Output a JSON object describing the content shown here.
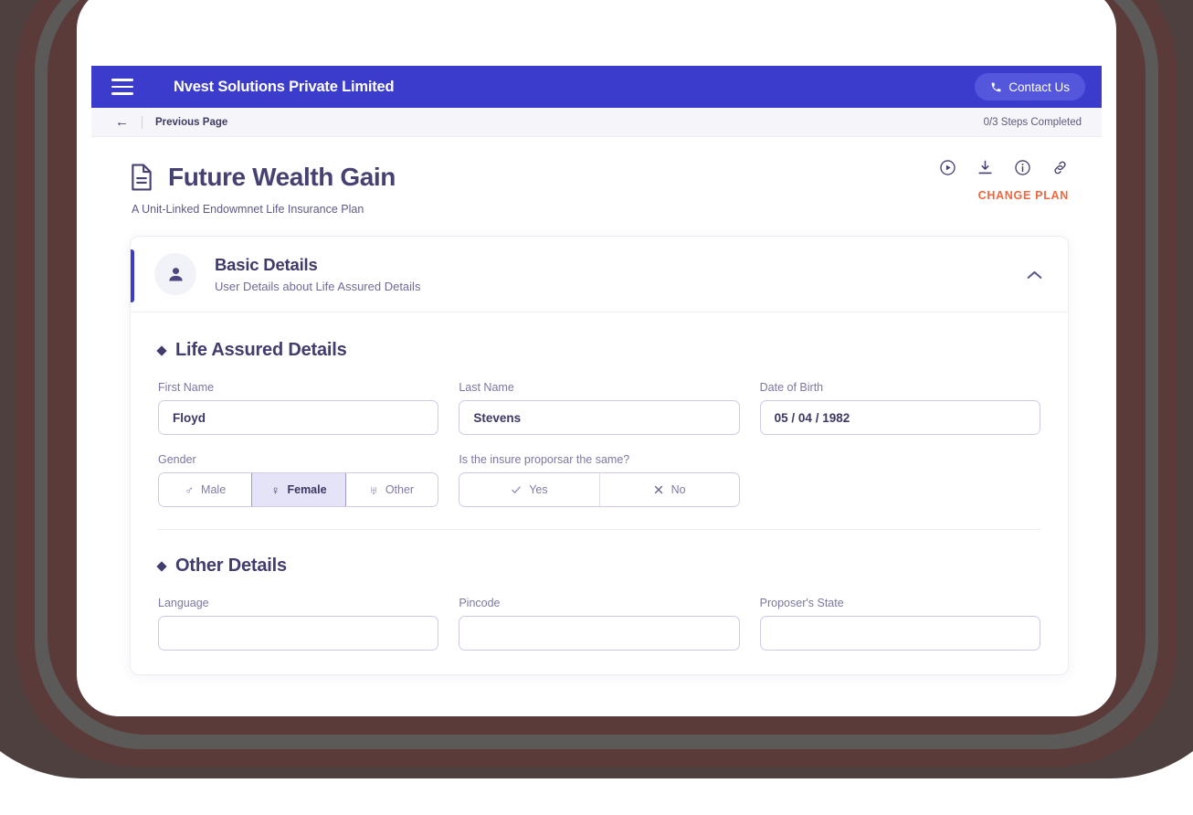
{
  "appbar": {
    "menu_icon": "hamburger-menu-icon",
    "brand": "Nvest Solutions Private Limited",
    "contact_label": "Contact Us",
    "contact_icon": "phone-icon",
    "bg_color": "#3b3ccc",
    "contact_bg_color": "#5457db"
  },
  "subbar": {
    "back_icon": "arrow-left-icon",
    "previous_page": "Previous Page",
    "steps": "0/3 Steps Completed"
  },
  "plan": {
    "doc_icon": "document-icon",
    "title": "Future Wealth Gain",
    "subtitle": "A Unit-Linked Endowmnet Life Insurance Plan",
    "change_plan": "CHANGE PLAN",
    "change_plan_color": "#f4663f",
    "actions": [
      {
        "name": "play-circle-icon"
      },
      {
        "name": "download-icon"
      },
      {
        "name": "info-circle-icon"
      },
      {
        "name": "link-icon"
      }
    ]
  },
  "section": {
    "avatar_icon": "person-icon",
    "title": "Basic Details",
    "subtitle": "User Details about Life Assured Details",
    "collapse_icon": "chevron-up-icon",
    "accent_color": "#3b3ccc"
  },
  "life_assured": {
    "group_title": "Life Assured Details",
    "first_name": {
      "label": "First Name",
      "value": "Floyd",
      "placeholder": "First Name"
    },
    "last_name": {
      "label": "Last Name",
      "value": "Stevens",
      "placeholder": "Last Name"
    },
    "dob": {
      "label": "Date of Birth",
      "value": "05 / 04 / 1982",
      "placeholder": "DD / MM / YYYY"
    },
    "gender": {
      "label": "Gender",
      "options": [
        {
          "label": "Male",
          "icon": "mars-icon",
          "glyph": "♂",
          "selected": false
        },
        {
          "label": "Female",
          "icon": "venus-icon",
          "glyph": "♀",
          "selected": true
        },
        {
          "label": "Other",
          "icon": "mars-venus-icon",
          "glyph": "⚥",
          "selected": false
        }
      ],
      "selected": "Female"
    },
    "insurer_same": {
      "label": "Is the insure proporsar the same?",
      "options": [
        {
          "label": "Yes",
          "icon": "check-icon",
          "selected": false
        },
        {
          "label": "No",
          "icon": "close-icon",
          "selected": false
        }
      ],
      "selected": ""
    }
  },
  "other_details": {
    "group_title": "Other Details",
    "language": {
      "label": "Language"
    },
    "pincode": {
      "label": "Pincode"
    },
    "proposer_state": {
      "label": "Proposer's State"
    }
  }
}
